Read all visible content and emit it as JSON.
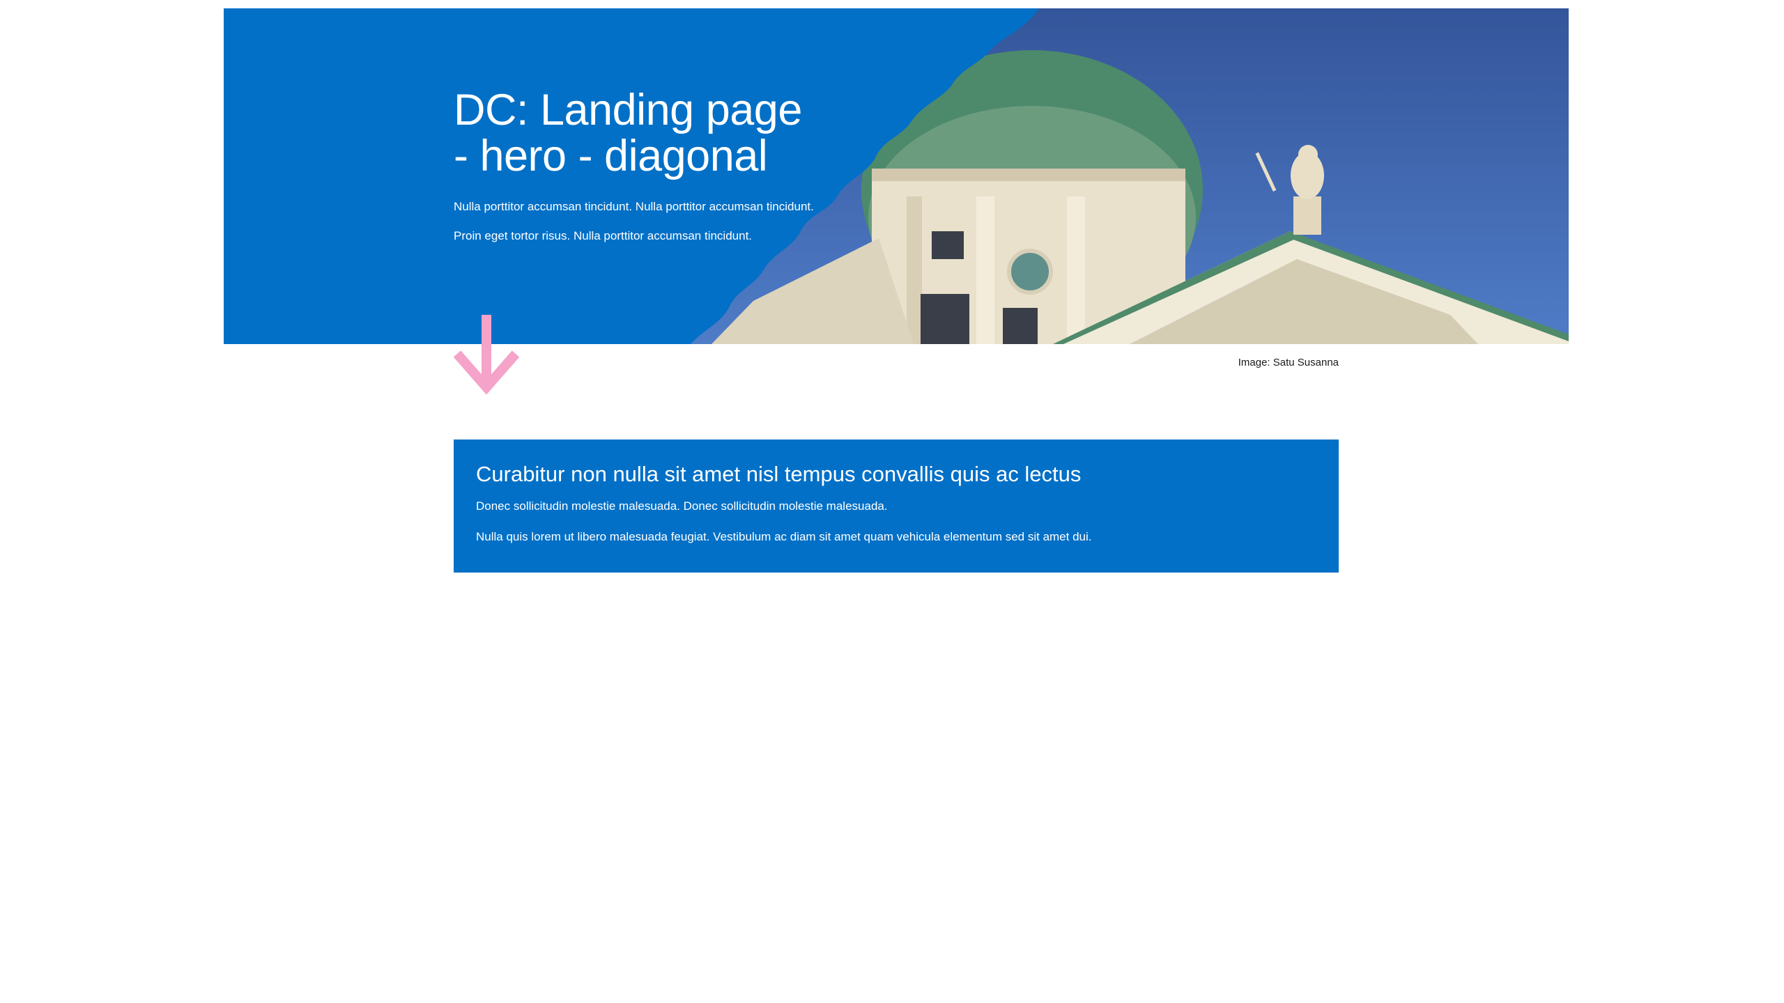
{
  "hero": {
    "title_line1": "DC: Landing page",
    "title_line2": "- hero - diagonal",
    "paragraph1": "Nulla porttitor accumsan tincidunt. Nulla porttitor accumsan tincidunt.",
    "paragraph2": "Proin eget tortor risus. Nulla porttitor accumsan tincidunt.",
    "background_color": "#0270c7",
    "image_credit": "Image: Satu Susanna"
  },
  "scroll_arrow": {
    "icon": "arrow-down-icon",
    "color": "#f5a3c8"
  },
  "card": {
    "title": "Curabitur non nulla sit amet nisl tempus convallis quis ac lectus",
    "paragraph1": "Donec sollicitudin molestie malesuada. Donec sollicitudin molestie malesuada.",
    "paragraph2": "Nulla quis lorem ut libero malesuada feugiat. Vestibulum ac diam sit amet quam vehicula elementum sed sit amet dui.",
    "background_color": "#0270c7"
  }
}
